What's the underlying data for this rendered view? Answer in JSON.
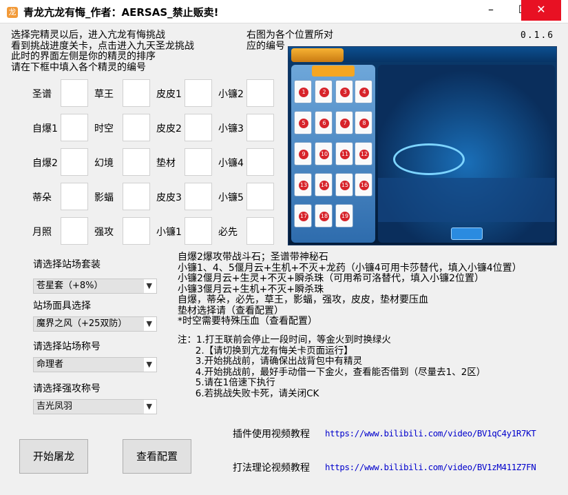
{
  "window": {
    "title": "青龙亢龙有悔_作者：AERSAS_禁止贩卖!",
    "min_label": "–",
    "max_label": "☐",
    "close_label": "✕"
  },
  "instructions": {
    "left": "选择完精灵以后，进入亢龙有悔挑战\n看到挑战进度关卡，点击进入九天圣龙挑战\n此时的界面左侧是你的精灵的排序\n请在下框中填入各个精灵的编号",
    "right": "右图为各个位置所对\n应的编号",
    "version": "0.1.6"
  },
  "grid": [
    [
      "圣谱",
      "草王",
      "皮皮1",
      "小镰2"
    ],
    [
      "自爆1",
      "时空",
      "皮皮2",
      "小镰3"
    ],
    [
      "自爆2",
      "幻境",
      "垫材",
      "小镰4"
    ],
    [
      "蒂朵",
      "影蝠",
      "皮皮3",
      "小镰5"
    ],
    [
      "月照",
      "强攻",
      "小镰1",
      "必先"
    ]
  ],
  "preview": {
    "cards": [
      "1",
      "2",
      "3",
      "4",
      "5",
      "6",
      "7",
      "8",
      "9",
      "10",
      "11",
      "12",
      "13",
      "14",
      "15",
      "16",
      "17",
      "18",
      "19"
    ]
  },
  "settings": {
    "suit_label": "请选择站场套装",
    "suit_value": "苍星套（+8%）",
    "mask_label": "站场面具选择",
    "mask_value": "魔界之风（+25双防）",
    "title_label": "请选择站场称号",
    "title_value": "命理者",
    "attack_label": "请选择强攻称号",
    "attack_value": "吉光凤羽"
  },
  "notes": "自爆2爆攻带战斗石；圣谱带神秘石\n小镰1、4、5偃月云+生机+不灭+龙药（小镰4可用卡莎替代，填入小镰4位置）\n小镰2偃月云+生灵+不灭+瞬杀珠（可用希可洛替代，填入小镰2位置）\n小镰3偃月云+生机+不灭+瞬杀珠\n自爆，蒂朵，必先，草王，影蝠，强攻，皮皮，垫材要压血\n垫材选择请（查看配置）\n*时空需要特殊压血（查看配置）",
  "notes2": "注：1.打王联前会停止一段时间，等金火到时换绿火\n      2.【请切换到亢龙有悔关卡页面运行】\n      3.开始挑战前，请确保出战背包中有精灵\n      4.开始挑战前，最好手动借一下金火，查看能否借到（尽量去1、2区）\n      5.请在1倍速下执行\n      6.若挑战失败卡死，请关闭CK",
  "links": {
    "plugin_label": "插件使用视频教程",
    "plugin_url": "https://www.bilibili.com/video/BV1qC4y1R7KT",
    "theory_label": "打法理论视频教程",
    "theory_url": "https://www.bilibili.com/video/BV1zM411Z7FN"
  },
  "buttons": {
    "start": "开始屠龙",
    "view_config": "查看配置"
  }
}
